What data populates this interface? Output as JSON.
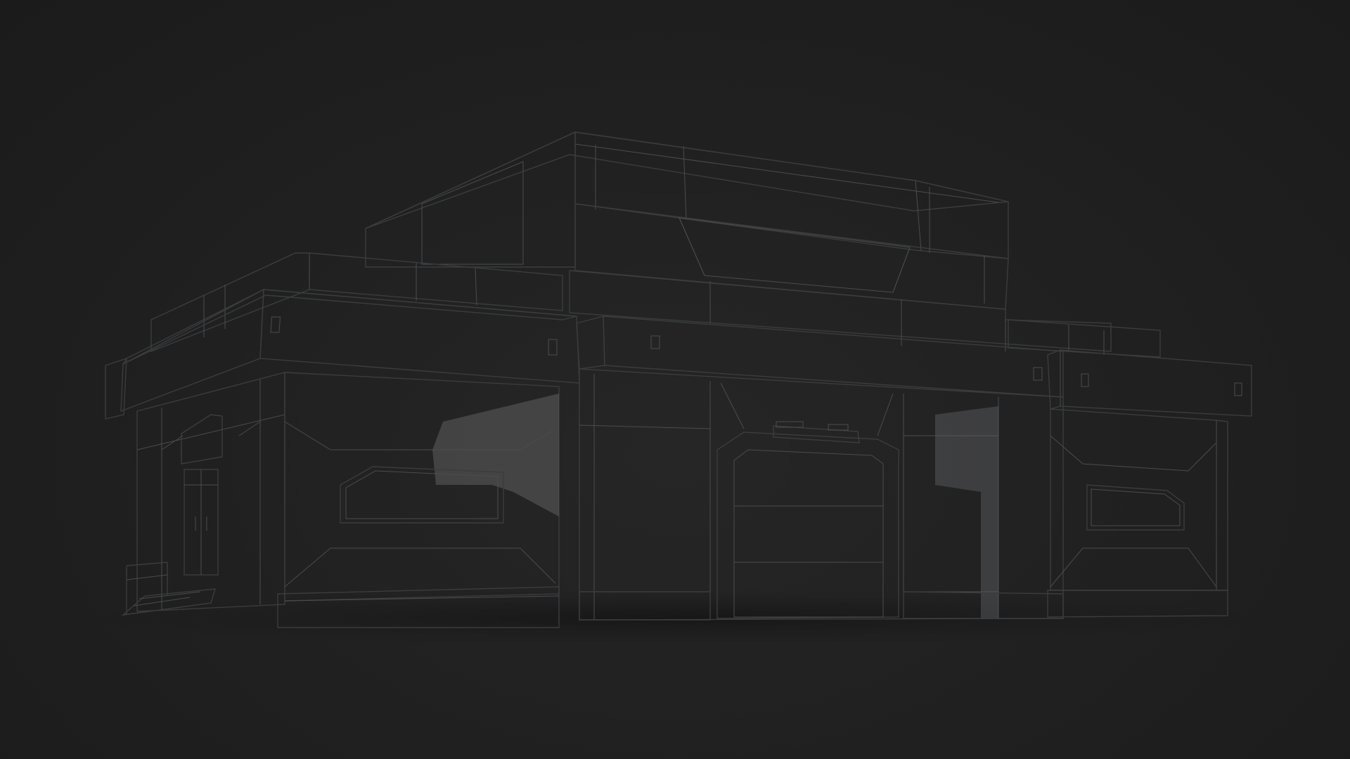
{
  "scene": {
    "subject": "",
    "colors": {
      "background": "#202020",
      "ground": "#1c1c1c",
      "wall_lit": "#8d8d8d",
      "wall_light": "#9a9a9a",
      "wall_shadow": "#5f6062",
      "wall_dark": "#6c6d6f",
      "roof_top": "#a3a3a3",
      "edge_lines": "#3a3c3e"
    }
  }
}
